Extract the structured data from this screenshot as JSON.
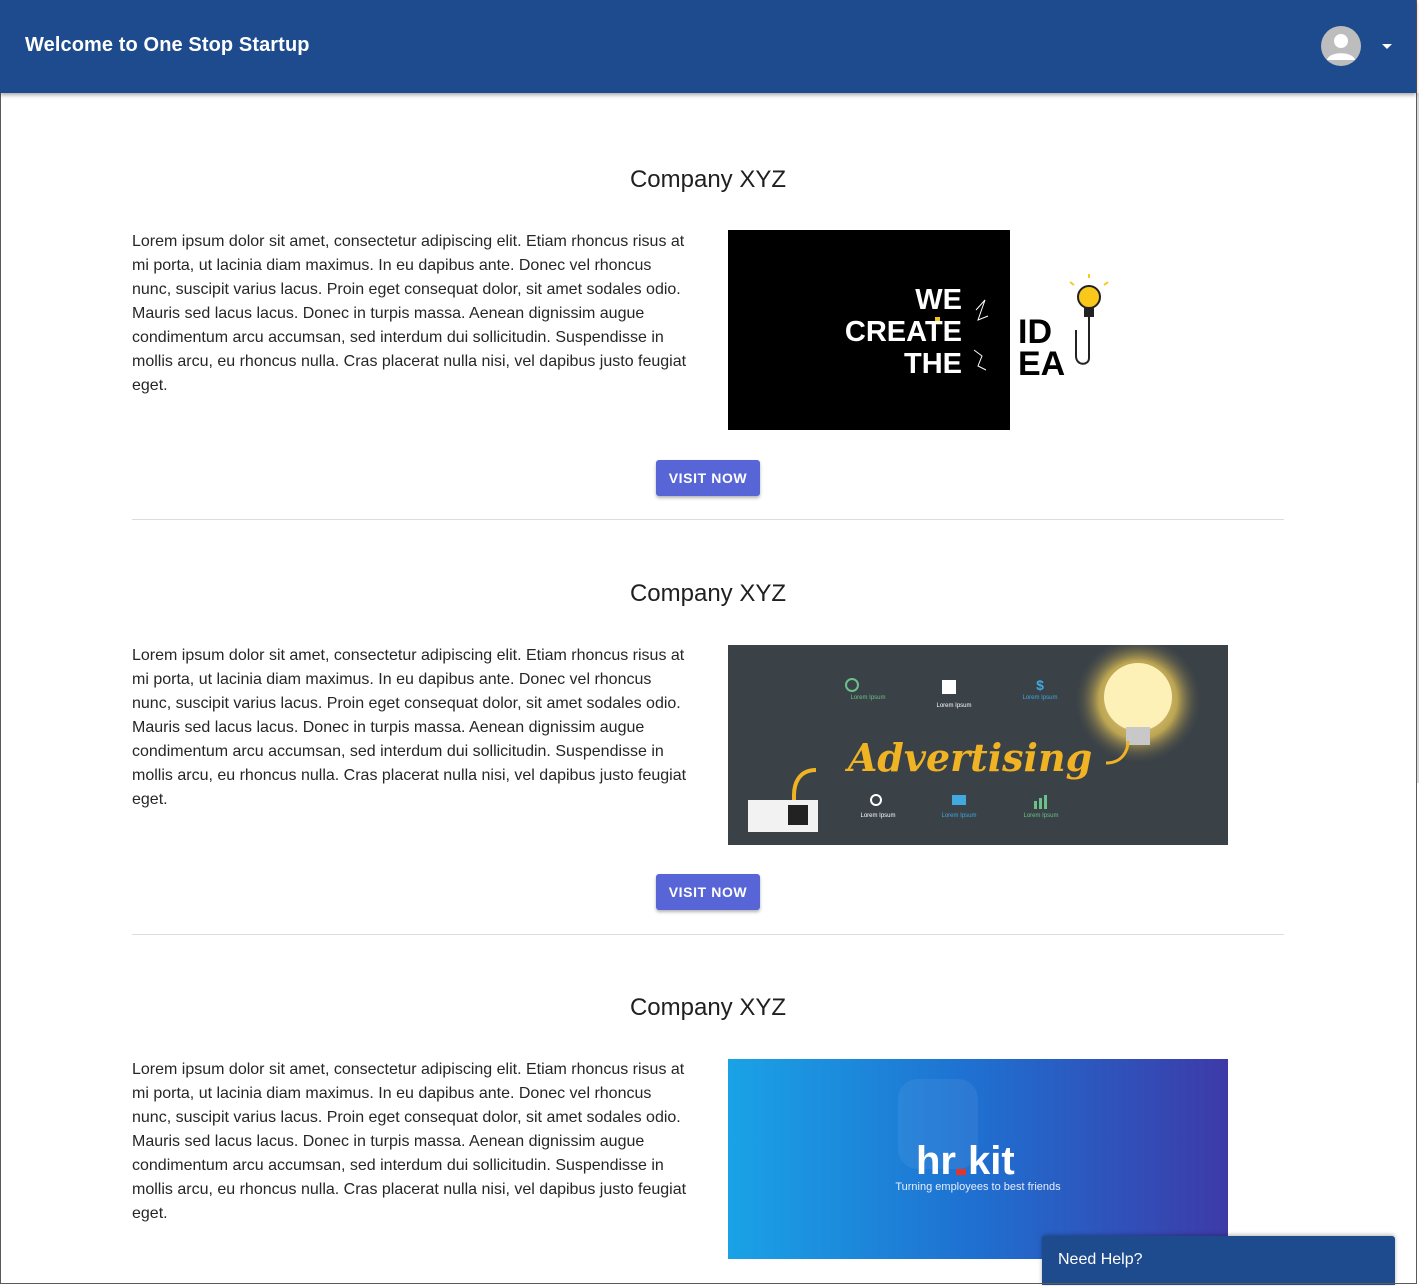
{
  "header": {
    "title": "Welcome to One Stop Startup",
    "account_icon": "account-circle-icon",
    "menu_icon": "caret-down-icon"
  },
  "colors": {
    "app_bar": "#1d4b8d",
    "button": "#5865d6",
    "help_bar": "#1d4b8d"
  },
  "companies": [
    {
      "title": "Company XYZ",
      "description": "Lorem ipsum dolor sit amet, consectetur adipiscing elit. Etiam rhoncus risus at mi porta, ut lacinia diam maximus. In eu dapibus ante. Donec vel rhoncus nunc, suscipit varius lacus. Proin eget consequat dolor, sit amet sodales odio. Mauris sed lacus lacus. Donec in turpis massa. Aenean dignissim augue condimentum arcu accumsan, sed interdum dui sollicitudin. Suspendisse in mollis arcu, eu rhoncus nulla. Cras placerat nulla nisi, vel dapibus justo feugiat eget.",
      "button": "VISIT NOW",
      "image": {
        "line1": "WE",
        "line2": "CREATE",
        "line3": "THE",
        "id_top": "ID",
        "id_bottom": "EA"
      }
    },
    {
      "title": "Company XYZ",
      "description": "Lorem ipsum dolor sit amet, consectetur adipiscing elit. Etiam rhoncus risus at mi porta, ut lacinia diam maximus. In eu dapibus ante. Donec vel rhoncus nunc, suscipit varius lacus. Proin eget consequat dolor, sit amet sodales odio. Mauris sed lacus lacus. Donec in turpis massa. Aenean dignissim augue condimentum arcu accumsan, sed interdum dui sollicitudin. Suspendisse in mollis arcu, eu rhoncus nulla. Cras placerat nulla nisi, vel dapibus justo feugiat eget.",
      "button": "VISIT NOW",
      "image": {
        "word": "Advertising",
        "caption": "Lorem Ipsum"
      }
    },
    {
      "title": "Company XYZ",
      "description": "Lorem ipsum dolor sit amet, consectetur adipiscing elit. Etiam rhoncus risus at mi porta, ut lacinia diam maximus. In eu dapibus ante. Donec vel rhoncus nunc, suscipit varius lacus. Proin eget consequat dolor, sit amet sodales odio. Mauris sed lacus lacus. Donec in turpis massa. Aenean dignissim augue condimentum arcu accumsan, sed interdum dui sollicitudin. Suspendisse in mollis arcu, eu rhoncus nulla. Cras placerat nulla nisi, vel dapibus justo feugiat eget.",
      "image": {
        "logo_left": "hr",
        "logo_right": "kit",
        "tagline": "Turning employees to best friends"
      }
    }
  ],
  "help": {
    "label": "Need Help?"
  }
}
